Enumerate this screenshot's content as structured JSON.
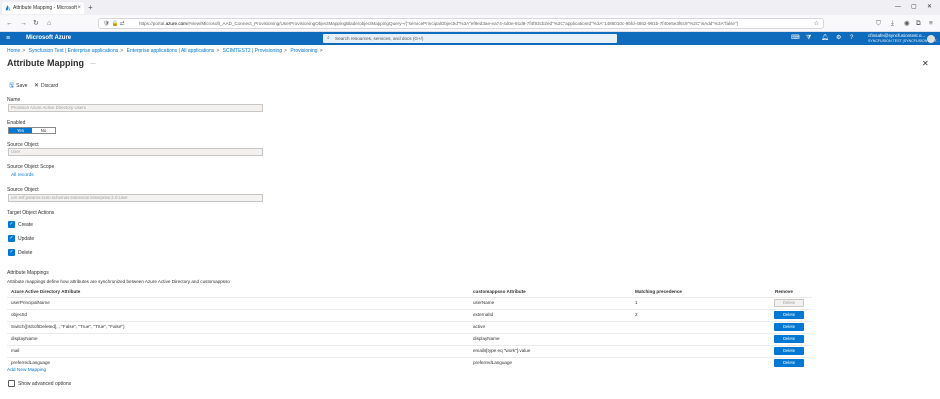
{
  "browser": {
    "tab_title": "Attribute Mapping - Microsoft",
    "url_prefix": "https://portal.",
    "url_domain": "azure.com",
    "url_rest": "/#view/Microsoft_AAD_Connect_Provisioning/UserProvisioningObjectMappingBlade/objectMappingQuery~/{\"servicePrincipalObjectId\"%3A\"ef9ed3ae-ea74-4d0e-91d8-7f4f93cb2ed\"%2C\"applicationId\"%3A\"1486010c-9bfd-4862-961b-7f40e5e3f6c9\"%2C\"isAdd\"%3A\"false\"}"
  },
  "azure": {
    "brand": "Microsoft Azure",
    "search_placeholder": "Search resources, services, and docs (G+/)",
    "user_email": "cfinsafe@syncfusiontest.o...",
    "user_tenant": "SYNCFUSION TEST (SYNCFUSIONTEST..."
  },
  "breadcrumb": [
    "Home",
    "Syncfusion Test | Enterprise applications",
    "Enterprise applications | All applications",
    "SCIMTEST2 | Provisioning",
    "Provisioning"
  ],
  "page": {
    "title": "Attribute Mapping",
    "more": "…"
  },
  "commands": {
    "save": "Save",
    "discard": "Discard"
  },
  "form": {
    "name_label": "Name",
    "name_value": "Provision Azure Active Directory Users",
    "enabled_label": "Enabled",
    "enabled_yes": "Yes",
    "enabled_no": "No",
    "source_object_label": "Source Object",
    "source_object_value": "User",
    "source_scope_label": "Source Object Scope",
    "source_scope_value": "All records",
    "target_object_label": "Source Object",
    "target_object_value": "urn:ietf:params:scim:schemas:extension:enterprise:2.0:User",
    "target_actions_label": "Target Object Actions",
    "actions": [
      "Create",
      "Update",
      "Delete"
    ]
  },
  "mappings": {
    "title": "Attribute Mappings",
    "description": "Attribute mappings define how attributes are synchronized between Azure Active Directory and customappsso",
    "headers": [
      "Azure Active Directory Attribute",
      "customappsso Attribute",
      "Matching precedence",
      "Remove"
    ],
    "rows": [
      {
        "source": "userPrincipalName",
        "target": "userName",
        "precedence": "1",
        "action": "Delete",
        "disabled": true
      },
      {
        "source": "objectId",
        "target": "externalId",
        "precedence": "2",
        "action": "Delete",
        "disabled": false
      },
      {
        "source": "Switch([IsSoftDeleted], , \"False\", \"True\", \"True\", \"False\")",
        "target": "active",
        "precedence": "",
        "action": "Delete",
        "disabled": false
      },
      {
        "source": "displayName",
        "target": "displayName",
        "precedence": "",
        "action": "Delete",
        "disabled": false
      },
      {
        "source": "mail",
        "target": "emails[type eq \"work\"].value",
        "precedence": "",
        "action": "Delete",
        "disabled": false
      },
      {
        "source": "preferredLanguage",
        "target": "preferredLanguage",
        "precedence": "",
        "action": "Delete",
        "disabled": false
      }
    ],
    "add_new": "Add New Mapping",
    "show_advanced": "Show advanced options"
  },
  "colors": {
    "azure_bar": "#0f6cbd",
    "accent": "#0078d4"
  }
}
